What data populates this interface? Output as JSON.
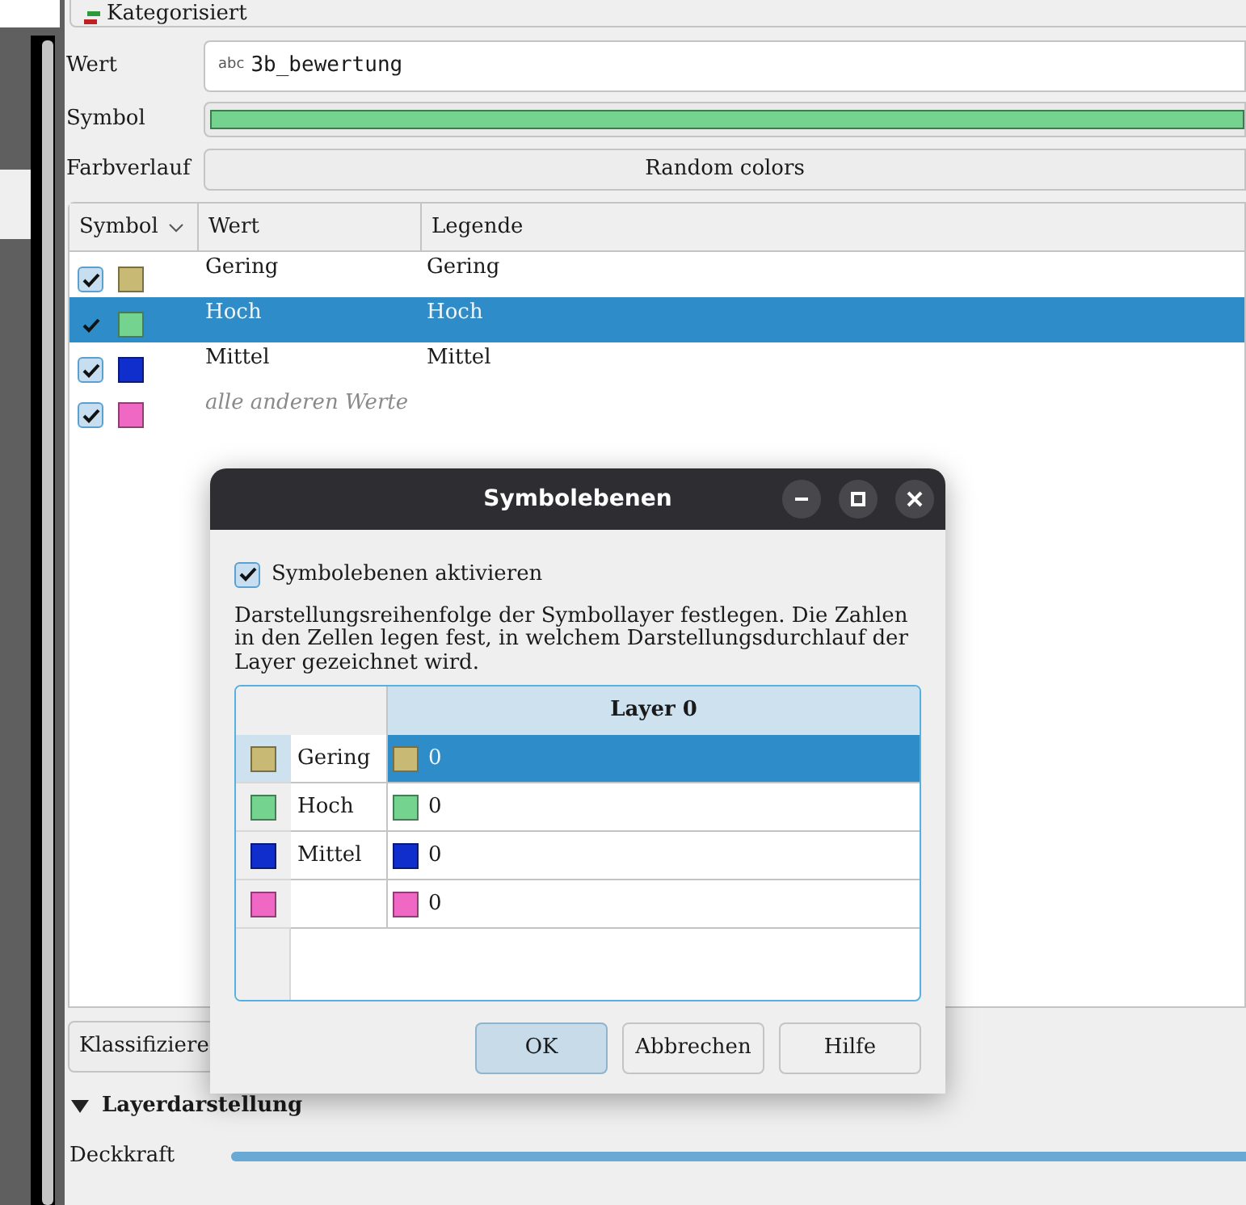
{
  "renderer": {
    "label": "Kategorisiert"
  },
  "wert": {
    "label": "Wert",
    "type_badge": "abc",
    "value": "3b_bewertung"
  },
  "symbol": {
    "label": "Symbol",
    "color": "#73d38f"
  },
  "farbverlauf": {
    "label": "Farbverlauf",
    "value": "Random colors"
  },
  "categories": {
    "columns": [
      "Symbol",
      "Wert",
      "Legende"
    ],
    "rows": [
      {
        "checked": true,
        "selected": false,
        "color": "#c8b974",
        "value": "Gering",
        "legend": "Gering",
        "kind": "value"
      },
      {
        "checked": true,
        "selected": true,
        "color": "#73d38f",
        "value": "Hoch",
        "legend": "Hoch",
        "kind": "value"
      },
      {
        "checked": true,
        "selected": false,
        "color": "#0f2ecc",
        "value": "Mittel",
        "legend": "Mittel",
        "kind": "value"
      },
      {
        "checked": true,
        "selected": false,
        "color": "#ee68c4",
        "value": "alle anderen Werte",
        "kind": "other"
      }
    ]
  },
  "classify_button": "Klassifiziere",
  "layer_rendering": {
    "title": "Layerdarstellung",
    "expanded": true,
    "opacity_label": "Deckkraft",
    "opacity": {
      "level": 1
    }
  },
  "dialog": {
    "title": "Symbolebenen",
    "enable": {
      "label": "Symbolebenen aktivieren",
      "checked": true
    },
    "description": "Darstellungsreihenfolge der Symbollayer festlegen. Die Zahlen in den Zellen legen fest, in welchem Darstellungsdurchlauf der Layer gezeichnet wird.",
    "table": {
      "columns": [
        "Layer 0"
      ],
      "rows": [
        {
          "color": "#c8b974",
          "name": "Gering",
          "value": "0",
          "selected": true
        },
        {
          "color": "#73d38f",
          "name": "Hoch",
          "value": "0",
          "selected": false
        },
        {
          "color": "#0f2ecc",
          "name": "Mittel",
          "value": "0",
          "selected": false
        },
        {
          "color": "#ee68c4",
          "value": "0",
          "selected": false
        }
      ]
    },
    "buttons": [
      {
        "label": "OK",
        "default": true
      },
      {
        "label": "Abbrechen",
        "default": false
      },
      {
        "label": "Hilfe",
        "default": false
      }
    ]
  }
}
